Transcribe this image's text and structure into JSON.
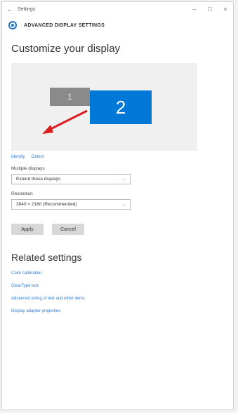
{
  "window": {
    "app_title": "Settings",
    "back_glyph": "←",
    "minimize_glyph": "–",
    "maximize_glyph": "□",
    "close_glyph": "×"
  },
  "header": {
    "title": "ADVANCED DISPLAY SETTINGS",
    "icon": "gear-icon",
    "accent_color": "#1a73c4"
  },
  "main": {
    "title": "Customize your display",
    "monitors": [
      {
        "label": "1",
        "color": "#8a8a8a"
      },
      {
        "label": "2",
        "color": "#0078d7",
        "selected": true
      }
    ],
    "annotation_arrow_color": "#d81e1e",
    "identify_label": "Identify",
    "detect_label": "Detect",
    "multiple_displays": {
      "label": "Multiple displays",
      "value": "Extend these displays"
    },
    "resolution": {
      "label": "Resolution",
      "value": "3840 × 2160 (Recommended)"
    },
    "apply_label": "Apply",
    "cancel_label": "Cancel"
  },
  "related": {
    "title": "Related settings",
    "links": [
      "Color calibration",
      "ClearType text",
      "Advanced sizing of text and other items",
      "Display adapter properties"
    ]
  },
  "colors": {
    "link": "#2c7bd8",
    "button_bg": "#d8d8d8"
  }
}
